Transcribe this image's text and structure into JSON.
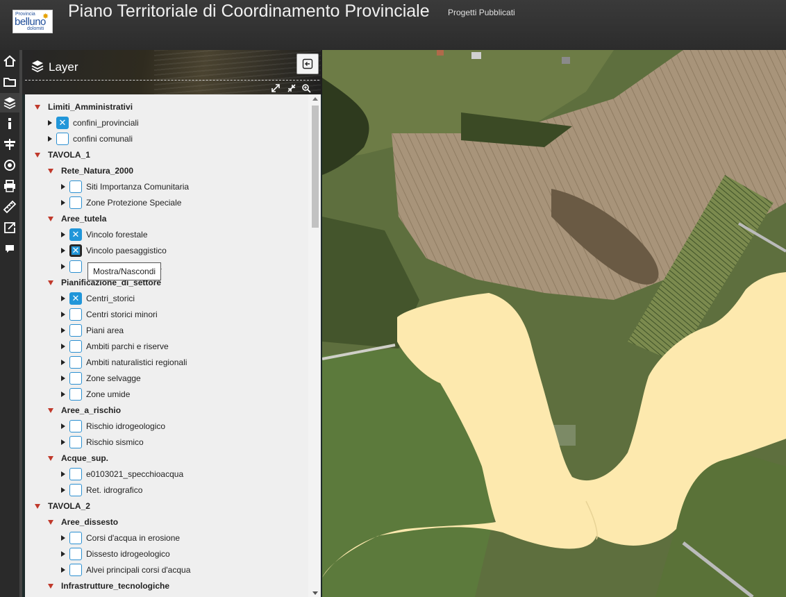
{
  "header": {
    "logo_small": "Provincia",
    "logo_main": "belluno",
    "logo_sub": "dolomiti",
    "title": "Piano Territoriale di Coordinamento Provinciale",
    "subtitle": "Progetti Pubblicati"
  },
  "toolbar": {
    "items": [
      "home-icon",
      "folder-icon",
      "layers-icon",
      "info-icon",
      "signpost-icon",
      "target-icon",
      "print-icon",
      "ruler-icon",
      "share-icon",
      "comment-icon"
    ]
  },
  "panel": {
    "title": "Layer",
    "tooltip": "Mostra/Nascondi"
  },
  "tree": [
    {
      "label": "Limiti_Amministrativi",
      "level": 0,
      "type": "group"
    },
    {
      "label": "confini_provinciali",
      "level": 1,
      "type": "layer",
      "checked": true
    },
    {
      "label": "confini comunali",
      "level": 1,
      "type": "layer",
      "checked": false
    },
    {
      "label": "TAVOLA_1",
      "level": 0,
      "type": "group"
    },
    {
      "label": "Rete_Natura_2000",
      "level": 1,
      "type": "group"
    },
    {
      "label": "Siti Importanza Comunitaria",
      "level": 2,
      "type": "layer",
      "checked": false
    },
    {
      "label": "Zone Protezione Speciale",
      "level": 2,
      "type": "layer",
      "checked": false
    },
    {
      "label": "Aree_tutela",
      "level": 1,
      "type": "group"
    },
    {
      "label": "Vincolo forestale",
      "level": 2,
      "type": "layer",
      "checked": true
    },
    {
      "label": "Vincolo paesaggistico",
      "level": 2,
      "type": "layer",
      "checked": true,
      "focused": true
    },
    {
      "label": "a",
      "level": 2,
      "type": "layer",
      "checked": false
    },
    {
      "label": "Pianificazione_di_settore",
      "level": 1,
      "type": "group"
    },
    {
      "label": "Centri_storici",
      "level": 2,
      "type": "layer",
      "checked": true
    },
    {
      "label": "Centri storici minori",
      "level": 2,
      "type": "layer",
      "checked": false
    },
    {
      "label": "Piani area",
      "level": 2,
      "type": "layer",
      "checked": false
    },
    {
      "label": "Ambiti parchi e riserve",
      "level": 2,
      "type": "layer",
      "checked": false
    },
    {
      "label": "Ambiti naturalistici regionali",
      "level": 2,
      "type": "layer",
      "checked": false
    },
    {
      "label": "Zone selvagge",
      "level": 2,
      "type": "layer",
      "checked": false
    },
    {
      "label": "Zone umide",
      "level": 2,
      "type": "layer",
      "checked": false
    },
    {
      "label": "Aree_a_rischio",
      "level": 1,
      "type": "group"
    },
    {
      "label": "Rischio idrogeologico",
      "level": 2,
      "type": "layer",
      "checked": false
    },
    {
      "label": "Rischio sismico",
      "level": 2,
      "type": "layer",
      "checked": false
    },
    {
      "label": "Acque_sup.",
      "level": 1,
      "type": "group"
    },
    {
      "label": "e0103021_specchioacqua",
      "level": 2,
      "type": "layer",
      "checked": false
    },
    {
      "label": "Ret. idrografico",
      "level": 2,
      "type": "layer",
      "checked": false
    },
    {
      "label": "TAVOLA_2",
      "level": 0,
      "type": "group"
    },
    {
      "label": "Aree_dissesto",
      "level": 1,
      "type": "group"
    },
    {
      "label": "Corsi d'acqua in erosione",
      "level": 2,
      "type": "layer",
      "checked": false
    },
    {
      "label": "Dissesto idrogeologico",
      "level": 2,
      "type": "layer",
      "checked": false
    },
    {
      "label": "Alvei principali corsi d'acqua",
      "level": 2,
      "type": "layer",
      "checked": false
    },
    {
      "label": "Infrastrutture_tecnologiche",
      "level": 1,
      "type": "group"
    }
  ],
  "colors": {
    "accent": "#2196d9",
    "expand_arrow": "#c0392b",
    "map_overlay": "#fde9ae"
  }
}
